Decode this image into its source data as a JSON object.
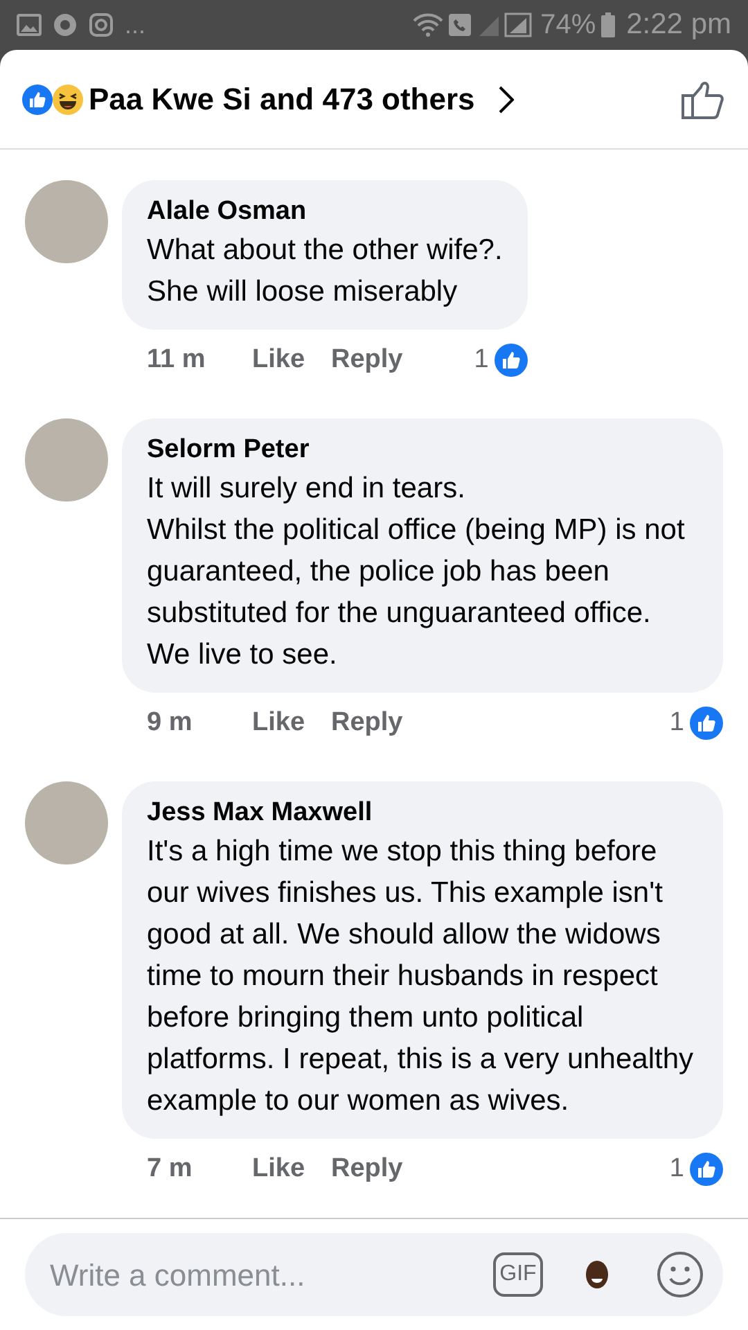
{
  "status_bar": {
    "battery": "74%",
    "time": "2:22 pm",
    "more": "..."
  },
  "header": {
    "title": "Paa Kwe Si and 473 others"
  },
  "comments": [
    {
      "author": "Alale Osman",
      "paragraphs": [
        "What about the other wife?.",
        "She will loose miserably"
      ],
      "time": "11 m",
      "like": "Like",
      "reply": "Reply",
      "reactions": "1"
    },
    {
      "author": "Selorm Peter",
      "paragraphs": [
        "It will surely end in tears.",
        "Whilst the political office (being MP) is not guaranteed, the police job has been substituted for the unguaranteed office.",
        "We live to see."
      ],
      "time": "9 m",
      "like": "Like",
      "reply": "Reply",
      "reactions": "1"
    },
    {
      "author": "Jess Max Maxwell",
      "paragraphs": [
        "It's a high time we stop this thing before our wives finishes us. This example isn't good at all. We should allow the widows time to mourn their husbands in respect before bringing them unto political platforms. I repeat, this is a very unhealthy example to our women as wives."
      ],
      "time": "7 m",
      "like": "Like",
      "reply": "Reply",
      "reactions": "1"
    }
  ],
  "composer": {
    "placeholder": "Write a comment...",
    "gif": "GIF"
  }
}
